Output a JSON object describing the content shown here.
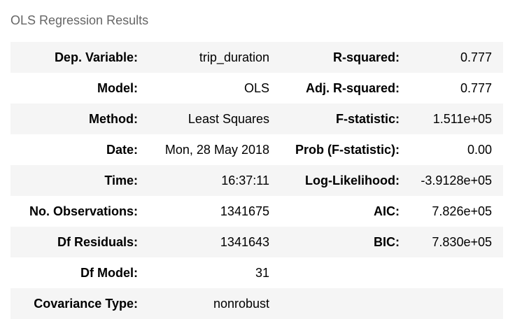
{
  "caption": "OLS Regression Results",
  "rows": [
    {
      "label1": "Dep. Variable:",
      "value1": "trip_duration",
      "label2": "R-squared:",
      "value2": "0.777"
    },
    {
      "label1": "Model:",
      "value1": "OLS",
      "label2": "Adj. R-squared:",
      "value2": "0.777"
    },
    {
      "label1": "Method:",
      "value1": "Least Squares",
      "label2": "F-statistic:",
      "value2": "1.511e+05"
    },
    {
      "label1": "Date:",
      "value1": "Mon, 28 May 2018",
      "label2": "Prob (F-statistic):",
      "value2": "0.00"
    },
    {
      "label1": "Time:",
      "value1": "16:37:11",
      "label2": "Log-Likelihood:",
      "value2": "-3.9128e+05"
    },
    {
      "label1": "No. Observations:",
      "value1": "1341675",
      "label2": "AIC:",
      "value2": "7.826e+05"
    },
    {
      "label1": "Df Residuals:",
      "value1": "1341643",
      "label2": "BIC:",
      "value2": "7.830e+05"
    },
    {
      "label1": "Df Model:",
      "value1": "31",
      "label2": "",
      "value2": ""
    },
    {
      "label1": "Covariance Type:",
      "value1": "nonrobust",
      "label2": "",
      "value2": ""
    }
  ]
}
